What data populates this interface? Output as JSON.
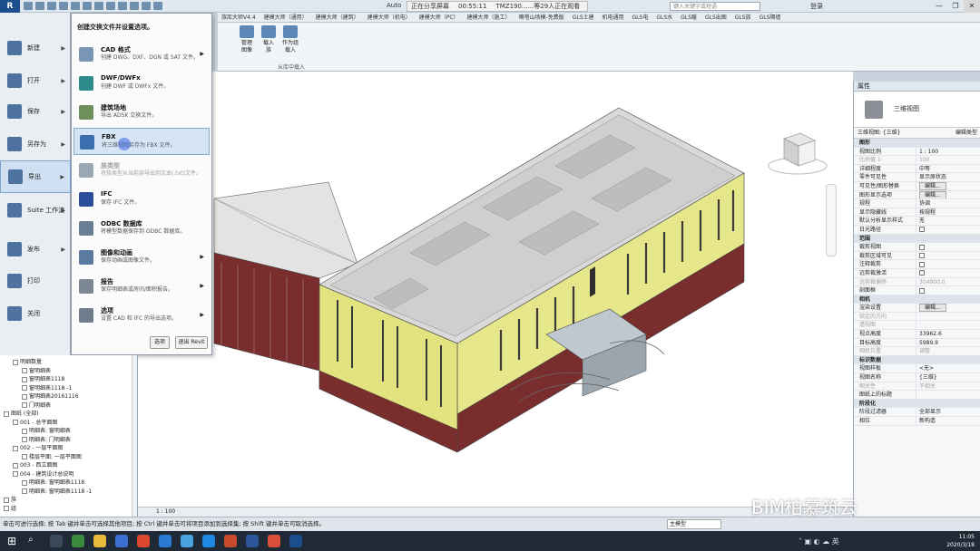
{
  "titlebar": {
    "logo": "R",
    "doc_title": "Auto",
    "share_status": "正在分享屏幕",
    "share_time": "00:55:11",
    "share_viewers": "TMZ190......等29人正在观看",
    "search_placeholder": "键入关键字或短语",
    "login": "登录"
  },
  "tabs": [
    "族库大师V4.4",
    "建模大师（通用）",
    "建模大师（建筑）",
    "建模大师（机电）",
    "建模大师（PC）",
    "建模大师（施工）",
    "嘀嗒山场模-免费版",
    "GLS土建",
    "机电通用",
    "GLS电",
    "GLS水",
    "GLS暖",
    "GLS出图",
    "GLS族",
    "GLS隔墙"
  ],
  "ribbon": {
    "buttons": [
      {
        "label": "管理\n图像"
      },
      {
        "label": "载入\n族"
      },
      {
        "label": "作为组\n载入"
      }
    ],
    "panel_label": "从库中载入"
  },
  "app_menu": {
    "items": [
      {
        "label": "新建"
      },
      {
        "label": "打开"
      },
      {
        "label": "保存"
      },
      {
        "label": "另存为"
      },
      {
        "label": "导出"
      },
      {
        "label": "Suite 工作流"
      },
      {
        "label": "发布"
      },
      {
        "label": "打印"
      },
      {
        "label": "关闭"
      }
    ]
  },
  "flyout": {
    "title": "创建交换文件并设置选项。",
    "items": [
      {
        "title": "CAD 格式",
        "desc": "创建 DWG、DXF、DGN 或 SAT 文件。",
        "arrow": "▶"
      },
      {
        "title": "DWF/DWFx",
        "desc": "创建 DWF 或 DWFx 文件。",
        "arrow": ""
      },
      {
        "title": "建筑场地",
        "desc": "导出 ADSK 交换文件。",
        "arrow": ""
      },
      {
        "title": "FBX",
        "desc": "将三维视图另存为 FBX 文件。",
        "arrow": ""
      },
      {
        "title": "族类型",
        "desc": "将族类型从当前族导出到文本(.txt)文件。",
        "arrow": ""
      },
      {
        "title": "IFC",
        "desc": "保存 IFC 文件。",
        "arrow": ""
      },
      {
        "title": "ODBC 数据库",
        "desc": "将模型数据保存到 ODBC 数据库。",
        "arrow": ""
      },
      {
        "title": "图像和动画",
        "desc": "保存动画或图像文件。",
        "arrow": "▶"
      },
      {
        "title": "报告",
        "desc": "保存明细表或房间/面积报告。",
        "arrow": "▶"
      },
      {
        "title": "选项",
        "desc": "设置 CAD 和 IFC 的导出选项。",
        "arrow": "▶"
      }
    ],
    "options_button": "选项",
    "exit_button": "退出 Revit"
  },
  "browser": {
    "rows": [
      {
        "text": "明细数量",
        "indent": 1
      },
      {
        "text": "窗明细表",
        "indent": 2
      },
      {
        "text": "窗明细表1118",
        "indent": 2
      },
      {
        "text": "窗明细表1118 -1",
        "indent": 2
      },
      {
        "text": "窗明细表20161116",
        "indent": 2
      },
      {
        "text": "门明细表",
        "indent": 2
      },
      {
        "text": "图纸 (全部)",
        "indent": 0
      },
      {
        "text": "001 - 总平面图",
        "indent": 1
      },
      {
        "text": "明细表: 窗明细表",
        "indent": 2
      },
      {
        "text": "明细表: 门明细表",
        "indent": 2
      },
      {
        "text": "002 - 一层平面图",
        "indent": 1
      },
      {
        "text": "楼层平面: 一层平面图",
        "indent": 2
      },
      {
        "text": "003 - 西立面图",
        "indent": 1
      },
      {
        "text": "004 - 建筑设计总说明",
        "indent": 1
      },
      {
        "text": "明细表: 窗明细表1118",
        "indent": 2
      },
      {
        "text": "明细表: 窗明细表1118 -1",
        "indent": 2
      },
      {
        "text": "族",
        "indent": 0
      },
      {
        "text": "组",
        "indent": 0
      }
    ]
  },
  "viewport": {
    "scale": "1 : 100",
    "viewcube_label": "左",
    "watermark": "BIM柏慕筑云"
  },
  "properties": {
    "title": "属性",
    "type_name": "三维视图",
    "selector": "三维视图: {三维}",
    "edit_type": "编辑类型",
    "rows": [
      {
        "k": "图形",
        "v": "",
        "kind": "group"
      },
      {
        "k": "视图比例",
        "v": "1 : 100",
        "kind": ""
      },
      {
        "k": "比例值 1:",
        "v": "100",
        "kind": "dim"
      },
      {
        "k": "详细程度",
        "v": "中等",
        "kind": ""
      },
      {
        "k": "零件可见性",
        "v": "显示原状态",
        "kind": ""
      },
      {
        "k": "可见性/图形替换",
        "v": "编辑...",
        "kind": "btn"
      },
      {
        "k": "图形显示选项",
        "v": "编辑...",
        "kind": "btn"
      },
      {
        "k": "规程",
        "v": "协调",
        "kind": ""
      },
      {
        "k": "显示隐藏线",
        "v": "按规程",
        "kind": ""
      },
      {
        "k": "默认分析显示样式",
        "v": "无",
        "kind": ""
      },
      {
        "k": "日光路径",
        "v": "",
        "kind": "cb"
      },
      {
        "k": "范围",
        "v": "",
        "kind": "group"
      },
      {
        "k": "裁剪视图",
        "v": "",
        "kind": "cb"
      },
      {
        "k": "裁剪区域可见",
        "v": "",
        "kind": "cb"
      },
      {
        "k": "注释裁剪",
        "v": "",
        "kind": "cb"
      },
      {
        "k": "远剪裁激活",
        "v": "",
        "kind": "cb"
      },
      {
        "k": "远剪裁偏移",
        "v": "304800.0",
        "kind": "dim"
      },
      {
        "k": "剖面框",
        "v": "",
        "kind": "cb"
      },
      {
        "k": "相机",
        "v": "",
        "kind": "group"
      },
      {
        "k": "渲染设置",
        "v": "编辑...",
        "kind": "btn"
      },
      {
        "k": "锁定的方向",
        "v": "",
        "kind": "dim"
      },
      {
        "k": "透视图",
        "v": "",
        "kind": "dim"
      },
      {
        "k": "视点高度",
        "v": "33962.6",
        "kind": ""
      },
      {
        "k": "目标高度",
        "v": "5989.9",
        "kind": ""
      },
      {
        "k": "相机位置",
        "v": "调整",
        "kind": "dim"
      },
      {
        "k": "标识数据",
        "v": "",
        "kind": "group"
      },
      {
        "k": "视图样板",
        "v": "<无>",
        "kind": ""
      },
      {
        "k": "视图名称",
        "v": "{三维}",
        "kind": ""
      },
      {
        "k": "相关性",
        "v": "不相关",
        "kind": "dim"
      },
      {
        "k": "图纸上的标题",
        "v": "",
        "kind": ""
      },
      {
        "k": "阶段化",
        "v": "",
        "kind": "group"
      },
      {
        "k": "阶段过滤器",
        "v": "全部显示",
        "kind": ""
      },
      {
        "k": "相位",
        "v": "新构造",
        "kind": ""
      }
    ]
  },
  "statusbar": {
    "hint": "单击可进行选择; 按 Tab 键并单击可选择其他项目; 按 Ctrl 键并单击可将项目添加到选择集; 按 Shift 键并单击可取消选择。",
    "model": "主模型"
  },
  "taskbar": {
    "time": "11:05",
    "date": "2020/3/18",
    "ime": "英"
  },
  "colors": {
    "facade_yellow": "#e6e68a",
    "brick_red": "#7a2d2d",
    "roof_gray": "#d6d6d6"
  }
}
